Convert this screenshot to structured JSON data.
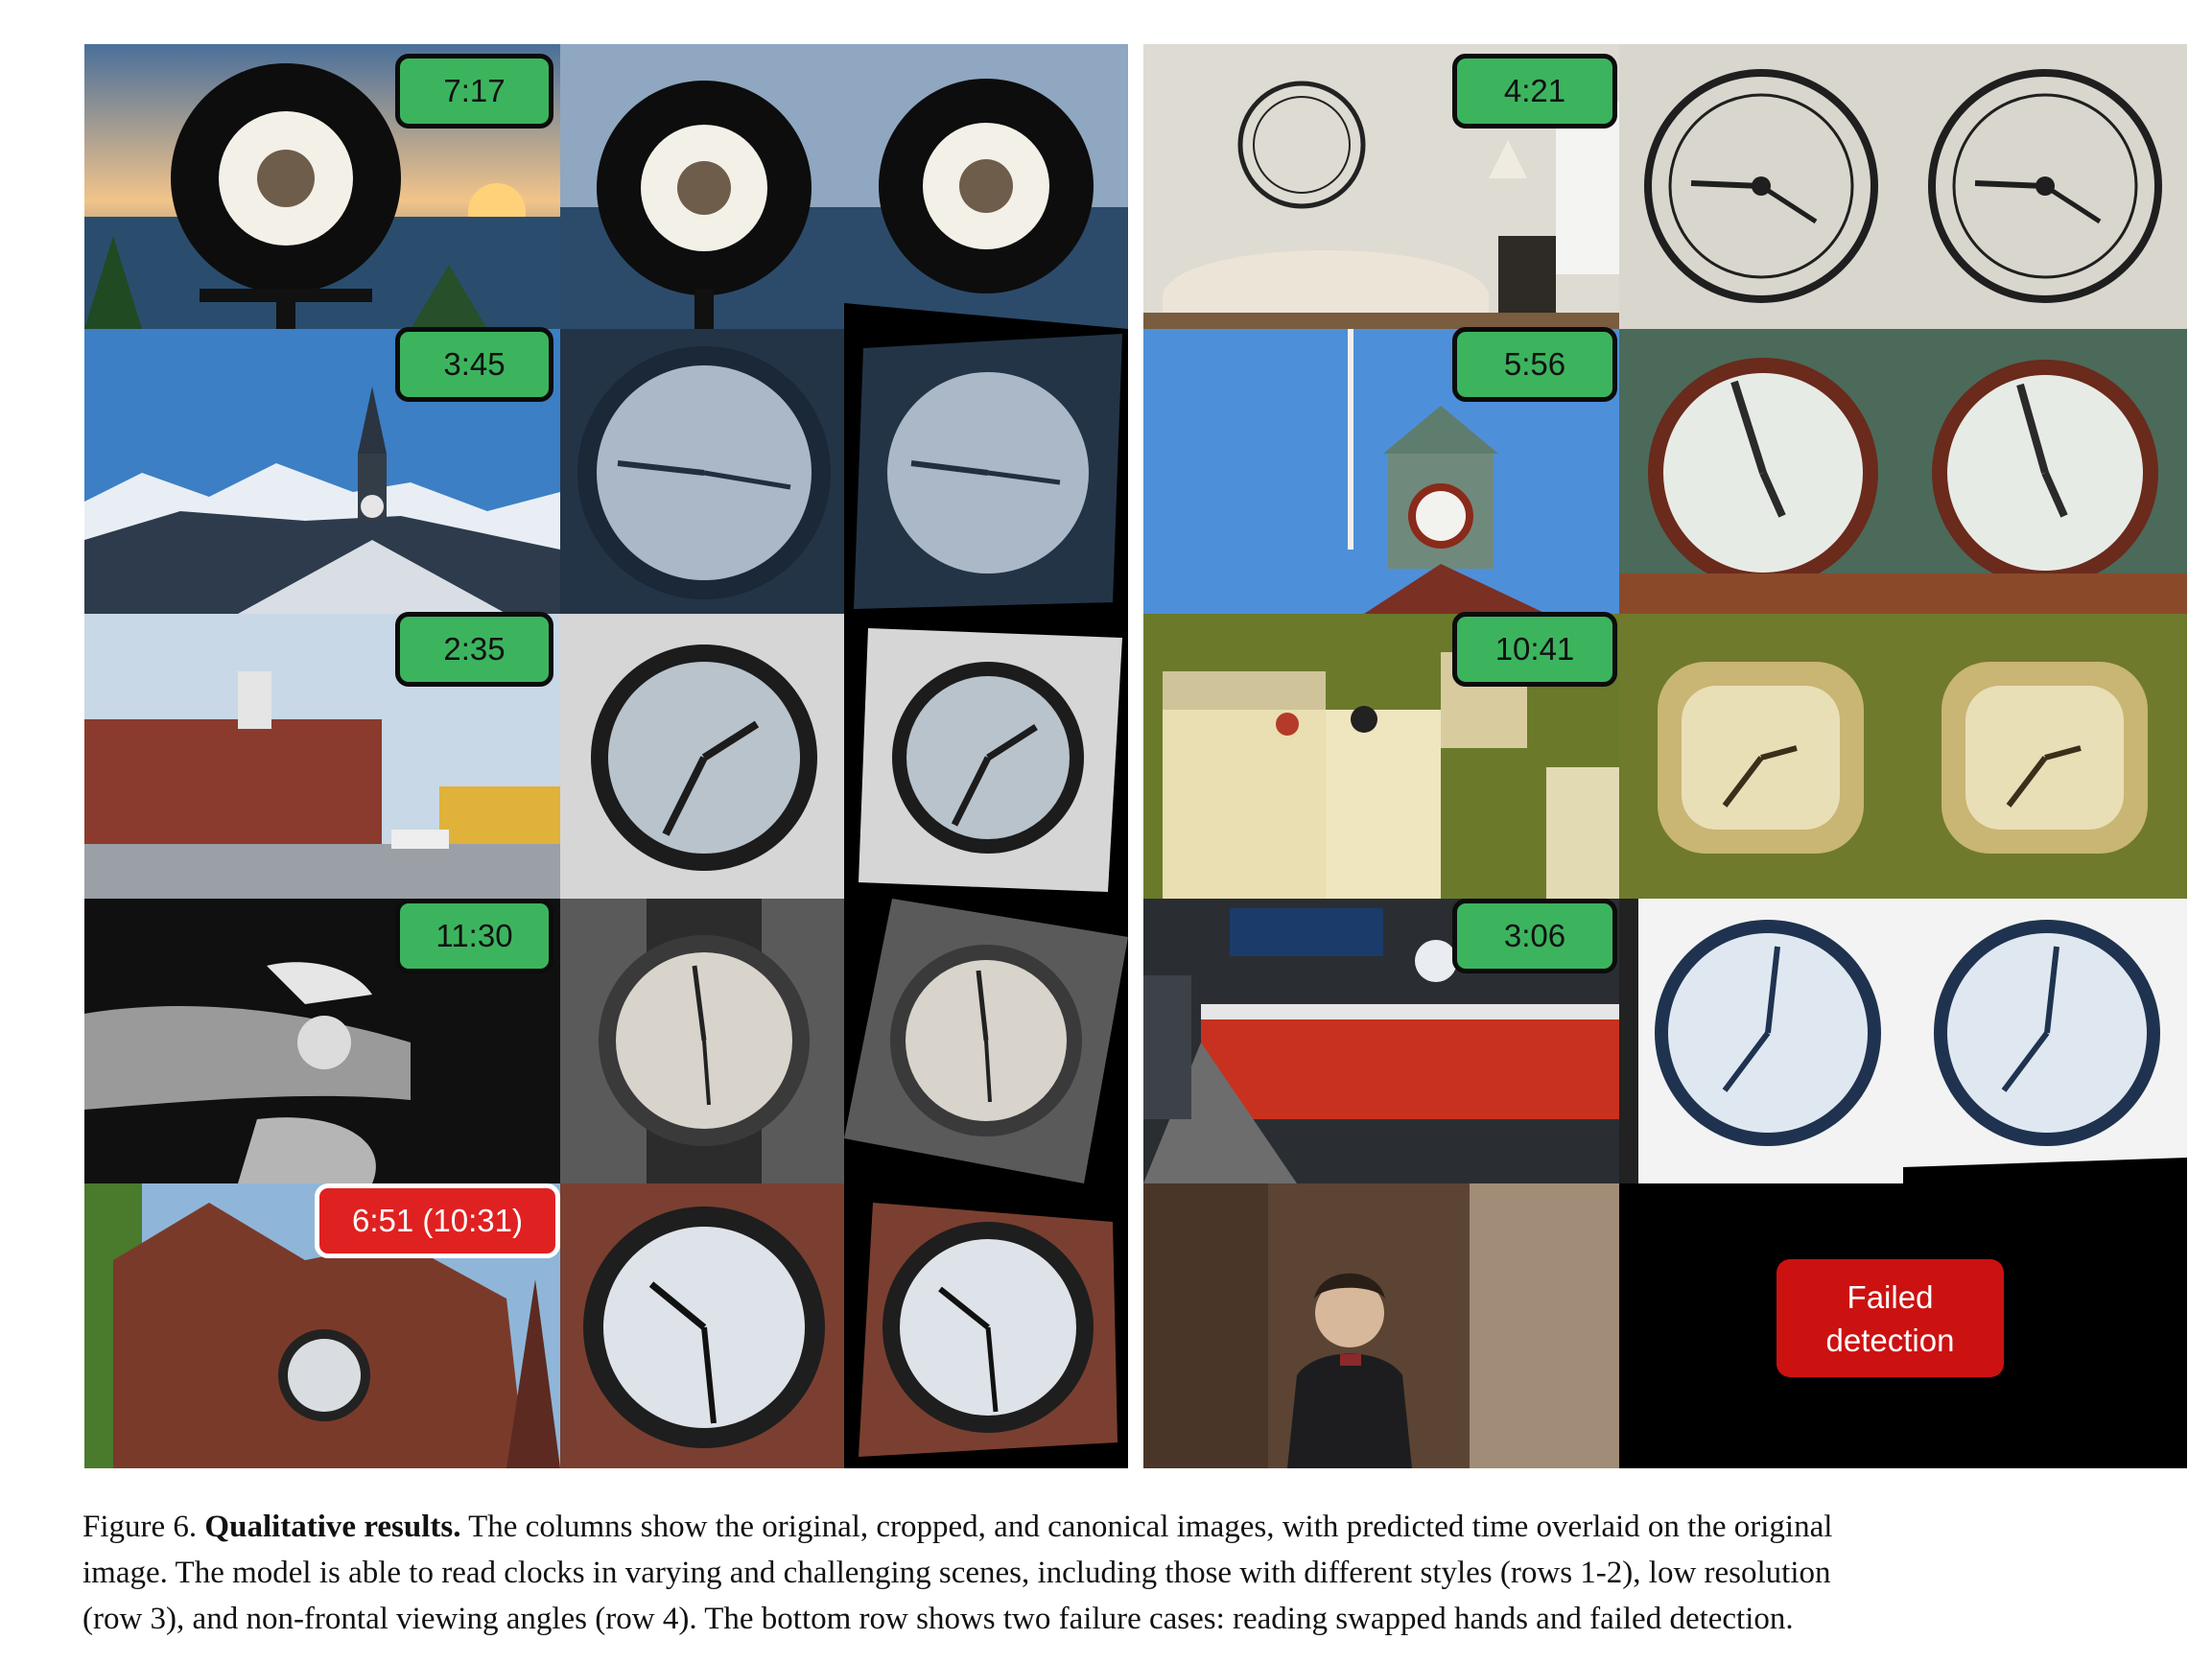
{
  "figure": {
    "rows": [
      {
        "left_time": "7:17",
        "right_time": "4:21"
      },
      {
        "left_time": "3:45",
        "right_time": "5:56"
      },
      {
        "left_time": "2:35",
        "right_time": "10:41"
      },
      {
        "left_time": "11:30",
        "right_time": "3:06"
      },
      {
        "left_time": "6:51 (10:31)"
      }
    ],
    "failed_line1": "Failed",
    "failed_line2": "detection",
    "colors": {
      "correct": "#3cb45e",
      "wrong": "#e02121",
      "failed": "#cc1111"
    }
  },
  "caption": {
    "label": "Figure 6.",
    "title": "Qualitative results.",
    "line1": "The columns show the original, cropped, and canonical images, with predicted time overlaid on the original",
    "line2": "image. The model is able to read clocks in varying and challenging scenes, including those with different styles (rows 1-2), low resolution",
    "line3": "(row 3), and non-frontal viewing angles (row 4). The bottom row shows two failure cases: reading swapped hands and failed detection."
  }
}
